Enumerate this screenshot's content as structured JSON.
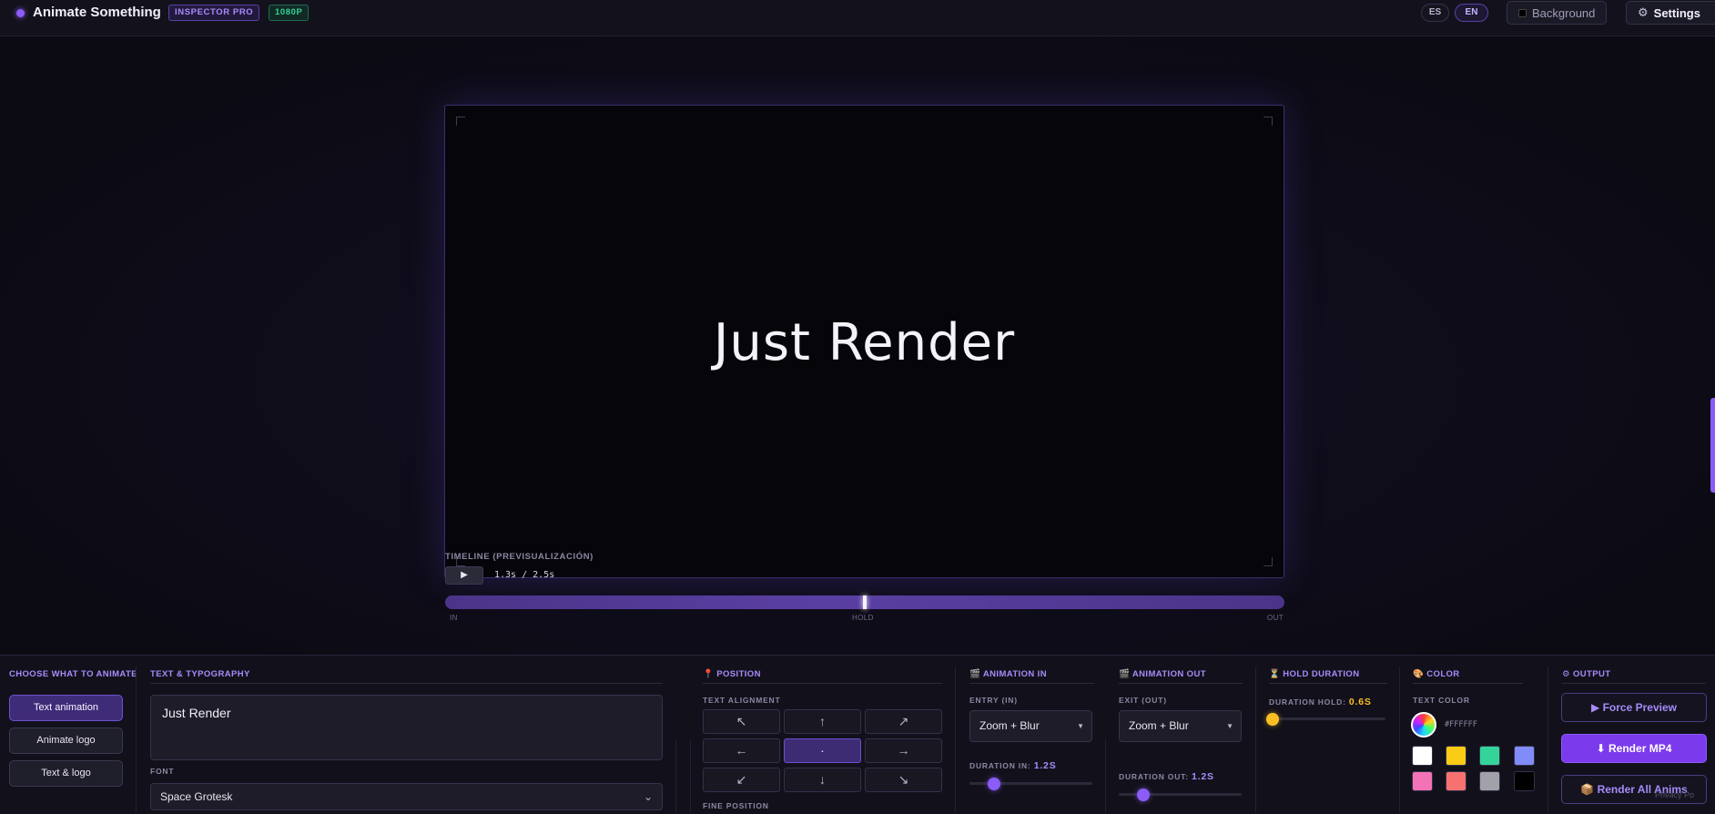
{
  "header": {
    "brand": "Animate Something",
    "badge_pro": "INSPECTOR PRO",
    "badge_resolution": "1080P",
    "lang_es": "ES",
    "lang_en": "EN",
    "background_label": "Background",
    "settings_label": "Settings"
  },
  "preview": {
    "text": "Just Render"
  },
  "timeline": {
    "label": "TIMELINE (PREVISUALIZACIÓN)",
    "play_icon": "▶",
    "time": "1.3s / 2.5s",
    "progress": 0.5,
    "marks": {
      "in": "IN",
      "hold": "HOLD",
      "out": "OUT"
    }
  },
  "choose": {
    "title": "CHOOSE WHAT TO ANIMATE",
    "options": [
      "Text animation",
      "Animate logo",
      "Text & logo"
    ],
    "selected": "Text animation"
  },
  "typography": {
    "title": "TEXT & TYPOGRAPHY",
    "text_value": "Just Render",
    "font_label": "FONT",
    "font_value": "Space Grotesk"
  },
  "position": {
    "title": "📍 POSITION",
    "alignment_label": "TEXT ALIGNMENT",
    "arrows": [
      "↖",
      "↑",
      "↗",
      "←",
      "·",
      "→",
      "↙",
      "↓",
      "↘"
    ],
    "selected": "·",
    "fine_label": "FINE POSITION"
  },
  "anim_in": {
    "title": "🎬 ANIMATION IN",
    "entry_label": "ENTRY (IN)",
    "entry_value": "Zoom + Blur",
    "duration_label": "DURATION IN:",
    "duration_value": "1.2S",
    "slider_level": 0.2
  },
  "anim_out": {
    "title": "🎬 ANIMATION OUT",
    "exit_label": "EXIT (OUT)",
    "exit_value": "Zoom + Blur",
    "duration_label": "DURATION OUT:",
    "duration_value": "1.2S",
    "slider_level": 0.2
  },
  "hold": {
    "title": "⏳ HOLD DURATION",
    "duration_label": "DURATION HOLD:",
    "duration_value": "0.6S",
    "slider_level": 0.03
  },
  "color": {
    "title": "🎨 COLOR",
    "text_color_label": "TEXT COLOR",
    "hex": "#FFFFFF",
    "swatches": [
      "#ffffff",
      "#facc15",
      "#34d399",
      "#818cf8",
      "#f472b6",
      "#f87171",
      "#a1a1aa",
      "#000000"
    ]
  },
  "output": {
    "title": "⚙ OUTPUT",
    "force_preview": "▶ Force Preview",
    "render_mp4": "⬇ Render MP4",
    "render_all": "📦 Render All Anims",
    "privacy": "Privacy Po"
  }
}
